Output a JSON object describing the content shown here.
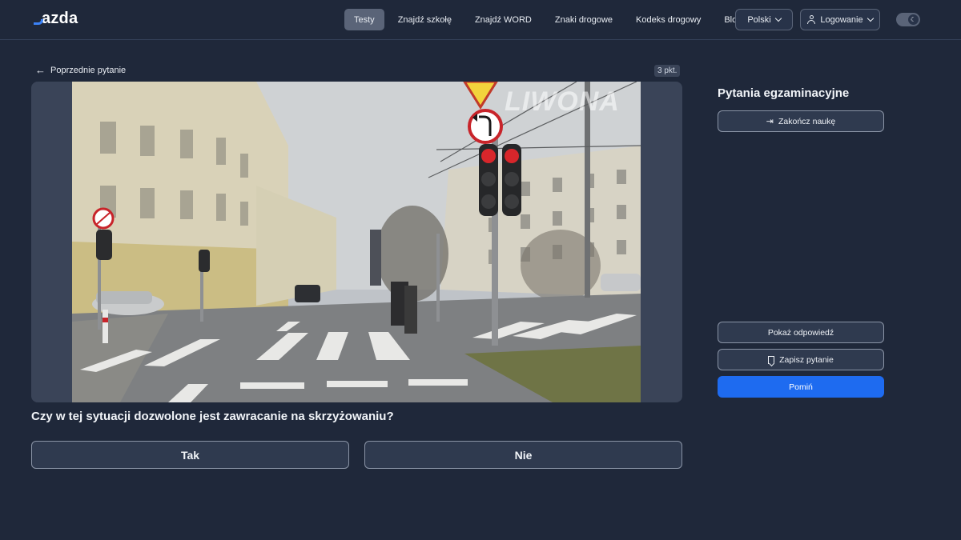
{
  "brand": {
    "logo_text": "azda"
  },
  "nav": {
    "items": [
      {
        "label": "Testy",
        "active": true
      },
      {
        "label": "Znajdź szkołę",
        "active": false
      },
      {
        "label": "Znajdź WORD",
        "active": false
      },
      {
        "label": "Znaki drogowe",
        "active": false
      },
      {
        "label": "Kodeks drogowy",
        "active": false
      },
      {
        "label": "Blog",
        "active": false
      }
    ],
    "language": "Polski",
    "login": "Logowanie"
  },
  "question_view": {
    "back_label": "Poprzednie pytanie",
    "points": "3 pkt.",
    "watermark": "LIWONA",
    "question_text": "Czy w tej sytuacji dozwolone jest zawracanie na skrzyżowaniu?",
    "answers": [
      {
        "label": "Tak"
      },
      {
        "label": "Nie"
      }
    ]
  },
  "sidebar": {
    "title": "Pytania egzaminacyjne",
    "end_button": "Zakończ naukę",
    "show_answer_button": "Pokaż odpowiedź",
    "save_button": "Zapisz pytanie",
    "skip_button": "Pomiń"
  },
  "colors": {
    "background": "#1f283a",
    "accent": "#1e6bf0",
    "surface": "#2f3a4f"
  },
  "icons": [
    "arrow-left-icon",
    "exit-icon",
    "bookmark-icon",
    "user-icon",
    "moon-icon",
    "chevron-down-icon"
  ]
}
